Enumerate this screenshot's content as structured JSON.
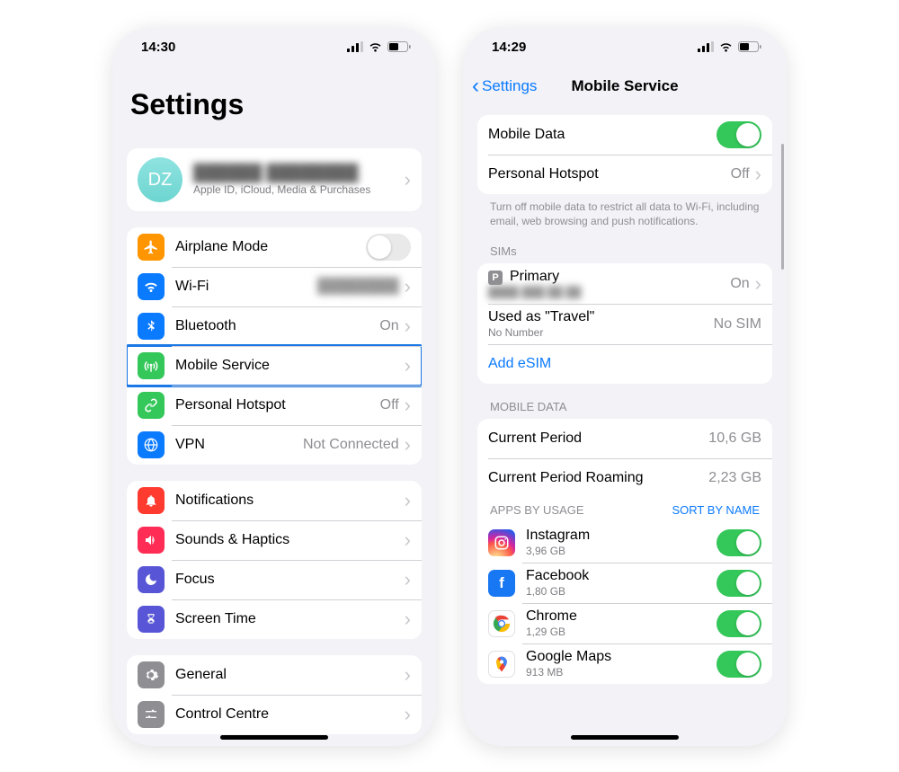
{
  "left": {
    "time": "14:30",
    "title": "Settings",
    "profile": {
      "initials": "DZ",
      "name_blurred": "██████ ████████",
      "subtitle": "Apple ID, iCloud, Media & Purchases"
    },
    "network_rows": [
      {
        "icon": "airplane",
        "color": "#ff9500",
        "label": "Airplane Mode",
        "toggle": false
      },
      {
        "icon": "wifi",
        "color": "#0a7aff",
        "label": "Wi-Fi",
        "value_blurred": "████████"
      },
      {
        "icon": "bluetooth",
        "color": "#0a7aff",
        "label": "Bluetooth",
        "value": "On"
      },
      {
        "icon": "antenna",
        "color": "#34c759",
        "label": "Mobile Service",
        "highlighted": true
      },
      {
        "icon": "link",
        "color": "#34c759",
        "label": "Personal Hotspot",
        "value": "Off"
      },
      {
        "icon": "globe",
        "color": "#0a7aff",
        "label": "VPN",
        "value": "Not Connected"
      }
    ],
    "system_rows": [
      {
        "icon": "bell",
        "color": "#ff3b30",
        "label": "Notifications"
      },
      {
        "icon": "speaker",
        "color": "#ff2d55",
        "label": "Sounds & Haptics"
      },
      {
        "icon": "moon",
        "color": "#5856d6",
        "label": "Focus"
      },
      {
        "icon": "hourglass",
        "color": "#5856d6",
        "label": "Screen Time"
      }
    ],
    "general_rows": [
      {
        "icon": "gear",
        "color": "#8e8e93",
        "label": "General"
      },
      {
        "icon": "sliders",
        "color": "#8e8e93",
        "label": "Control Centre"
      }
    ]
  },
  "right": {
    "time": "14:29",
    "back_label": "Settings",
    "title": "Mobile Service",
    "top_rows": {
      "mobile_data": "Mobile Data",
      "mobile_data_on": true,
      "personal_hotspot": "Personal Hotspot",
      "personal_hotspot_value": "Off"
    },
    "footer_text": "Turn off mobile data to restrict all data to Wi-Fi, including email, web browsing and push notifications.",
    "sims_header": "SIMs",
    "sims": [
      {
        "badge": "P",
        "title": "Primary",
        "sub_blurred": "████ ███ ██ ██",
        "value": "On",
        "chev": true
      },
      {
        "title": "Used as \"Travel\"",
        "sub": "No Number",
        "value": "No SIM"
      }
    ],
    "add_esim": "Add eSIM",
    "mobile_data_header": "MOBILE DATA",
    "usage": [
      {
        "label": "Current Period",
        "value": "10,6 GB"
      },
      {
        "label": "Current Period Roaming",
        "value": "2,23 GB"
      }
    ],
    "apps_header": "APPS BY USAGE",
    "sort_action": "SORT BY NAME",
    "apps": [
      {
        "icon": "instagram",
        "name": "Instagram",
        "usage": "3,96 GB",
        "on": true
      },
      {
        "icon": "facebook",
        "glyph": "f",
        "name": "Facebook",
        "usage": "1,80 GB",
        "on": true
      },
      {
        "icon": "chrome",
        "name": "Chrome",
        "usage": "1,29 GB",
        "on": true
      },
      {
        "icon": "maps",
        "name": "Google Maps",
        "usage": "913 MB",
        "on": true
      }
    ]
  }
}
